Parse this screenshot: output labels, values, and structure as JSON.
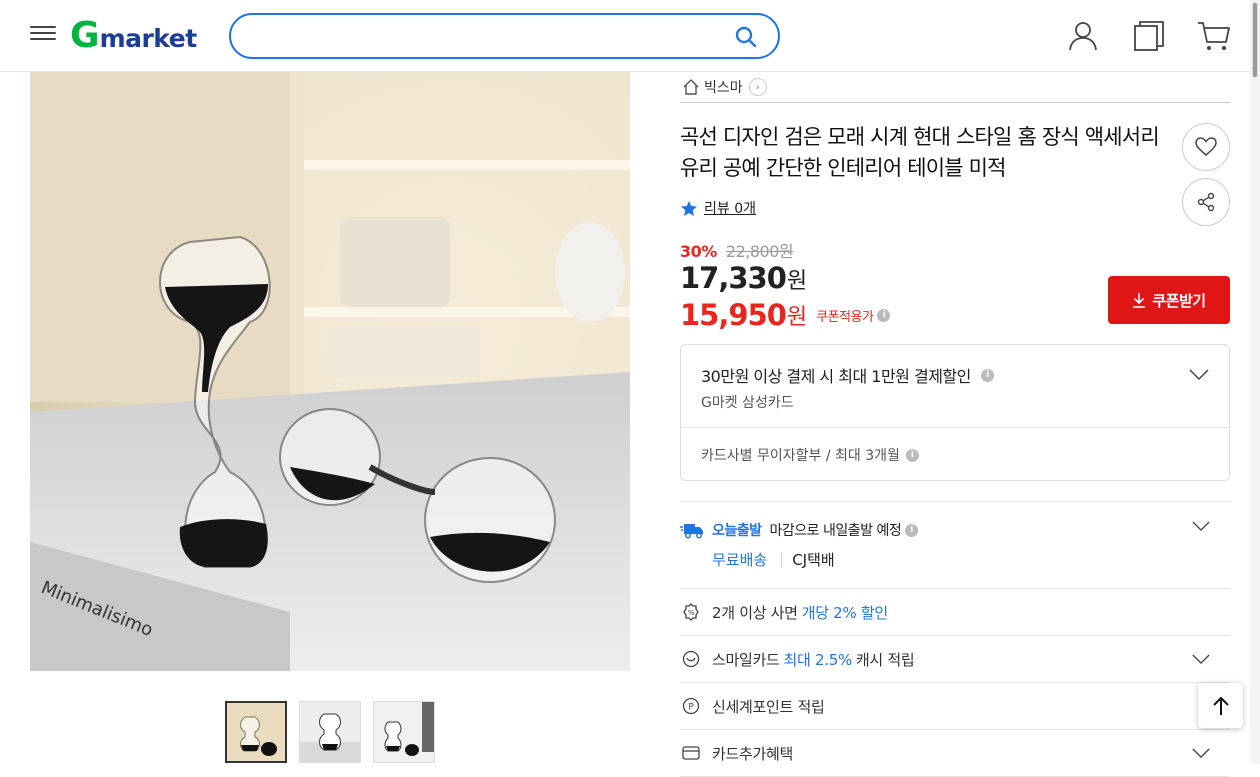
{
  "header": {
    "logo_g": "G",
    "logo_rest": "market",
    "search_value": "",
    "icons": [
      "menu-icon",
      "search-icon",
      "user-icon",
      "recent-items-icon",
      "cart-icon"
    ]
  },
  "product": {
    "shop_name": "빅스마",
    "title": "곡선 디자인 검은 모래 시계 현대 스타일 홈 장식 액세서리 유리 공예 간단한 인테리어 테이블 미적",
    "review_label": "리뷰 0개",
    "discount_rate": "30%",
    "original_price": "22,800원",
    "price_num": "17,330",
    "price_won": "원",
    "coupon_price_num": "15,950",
    "coupon_price_won": "원",
    "coupon_applied_label": "쿠폰적용가",
    "coupon_button_label": "쿠폰받기",
    "image_text": "Minimalisimo"
  },
  "card_benefit": {
    "title": "30만원 이상 결제 시 최대 1만원 결제할인",
    "card": "G마켓 삼성카드",
    "installment": "카드사별 무이자할부 / 최대 3개월"
  },
  "shipping": {
    "today_label": "오늘출발",
    "deadline": "마감으로 내일출발 예정",
    "free_label": "무료배송",
    "carrier": "CJ택배"
  },
  "benefits": [
    {
      "pre": "2개 이상 사면",
      "hl": "개당 2% 할인",
      "post": ""
    },
    {
      "pre": "스마일카드",
      "hl": "최대 2.5%",
      "post": "캐시 적립"
    },
    {
      "pre": "신세계포인트 적립",
      "hl": "",
      "post": ""
    },
    {
      "pre": "카드추가혜택",
      "hl": "",
      "post": ""
    }
  ],
  "colors": {
    "brand_green": "#00b53f",
    "brand_navy": "#1c3c99",
    "accent_blue": "#1f75e8",
    "sale_red": "#e8261d"
  }
}
